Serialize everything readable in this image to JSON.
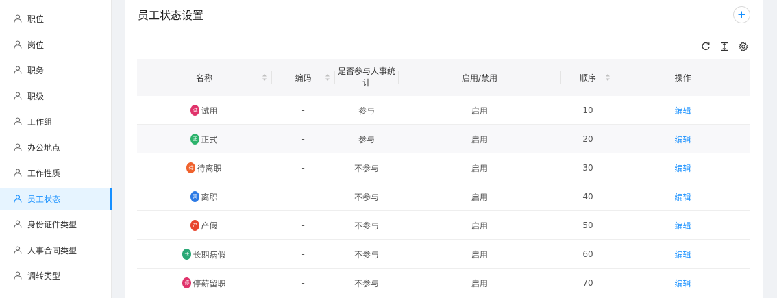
{
  "sidebar": {
    "items": [
      {
        "label": "职位",
        "active": false
      },
      {
        "label": "岗位",
        "active": false
      },
      {
        "label": "职务",
        "active": false
      },
      {
        "label": "职级",
        "active": false
      },
      {
        "label": "工作组",
        "active": false
      },
      {
        "label": "办公地点",
        "active": false
      },
      {
        "label": "工作性质",
        "active": false
      },
      {
        "label": "员工状态",
        "active": true
      },
      {
        "label": "身份证件类型",
        "active": false
      },
      {
        "label": "人事合同类型",
        "active": false
      },
      {
        "label": "调转类型",
        "active": false
      }
    ]
  },
  "page": {
    "title": "员工状态设置"
  },
  "toolbar": {
    "icons": [
      "add-icon",
      "refresh-icon",
      "column-height-icon",
      "settings-icon"
    ]
  },
  "table": {
    "columns": [
      {
        "label": "名称",
        "sortable": true
      },
      {
        "label": "编码",
        "sortable": true
      },
      {
        "label": "是否参与人事统计",
        "sortable": false
      },
      {
        "label": "启用/禁用",
        "sortable": false
      },
      {
        "label": "顺序",
        "sortable": true
      },
      {
        "label": "操作",
        "sortable": false
      }
    ],
    "rows": [
      {
        "badge": "试",
        "badge_color": "#e0336b",
        "name": "试用",
        "code": "-",
        "stat": "参与",
        "enabled": "启用",
        "order": "10",
        "action": "编辑"
      },
      {
        "badge": "正",
        "badge_color": "#2db36c",
        "name": "正式",
        "code": "-",
        "stat": "参与",
        "enabled": "启用",
        "order": "20",
        "action": "编辑"
      },
      {
        "badge": "待",
        "badge_color": "#f0622d",
        "name": "待离职",
        "code": "-",
        "stat": "不参与",
        "enabled": "启用",
        "order": "30",
        "action": "编辑"
      },
      {
        "badge": "离",
        "badge_color": "#2d7be5",
        "name": "离职",
        "code": "-",
        "stat": "不参与",
        "enabled": "启用",
        "order": "40",
        "action": "编辑"
      },
      {
        "badge": "产",
        "badge_color": "#e8452d",
        "name": "产假",
        "code": "-",
        "stat": "不参与",
        "enabled": "启用",
        "order": "50",
        "action": "编辑"
      },
      {
        "badge": "长",
        "badge_color": "#2aa876",
        "name": "长期病假",
        "code": "-",
        "stat": "不参与",
        "enabled": "启用",
        "order": "60",
        "action": "编辑"
      },
      {
        "badge": "停",
        "badge_color": "#e0336b",
        "name": "停薪留职",
        "code": "-",
        "stat": "不参与",
        "enabled": "启用",
        "order": "70",
        "action": "编辑"
      }
    ]
  },
  "colors": {
    "accent": "#1890ff",
    "active_bg": "#e6f4ff",
    "header_bg": "#f6f6f8"
  }
}
